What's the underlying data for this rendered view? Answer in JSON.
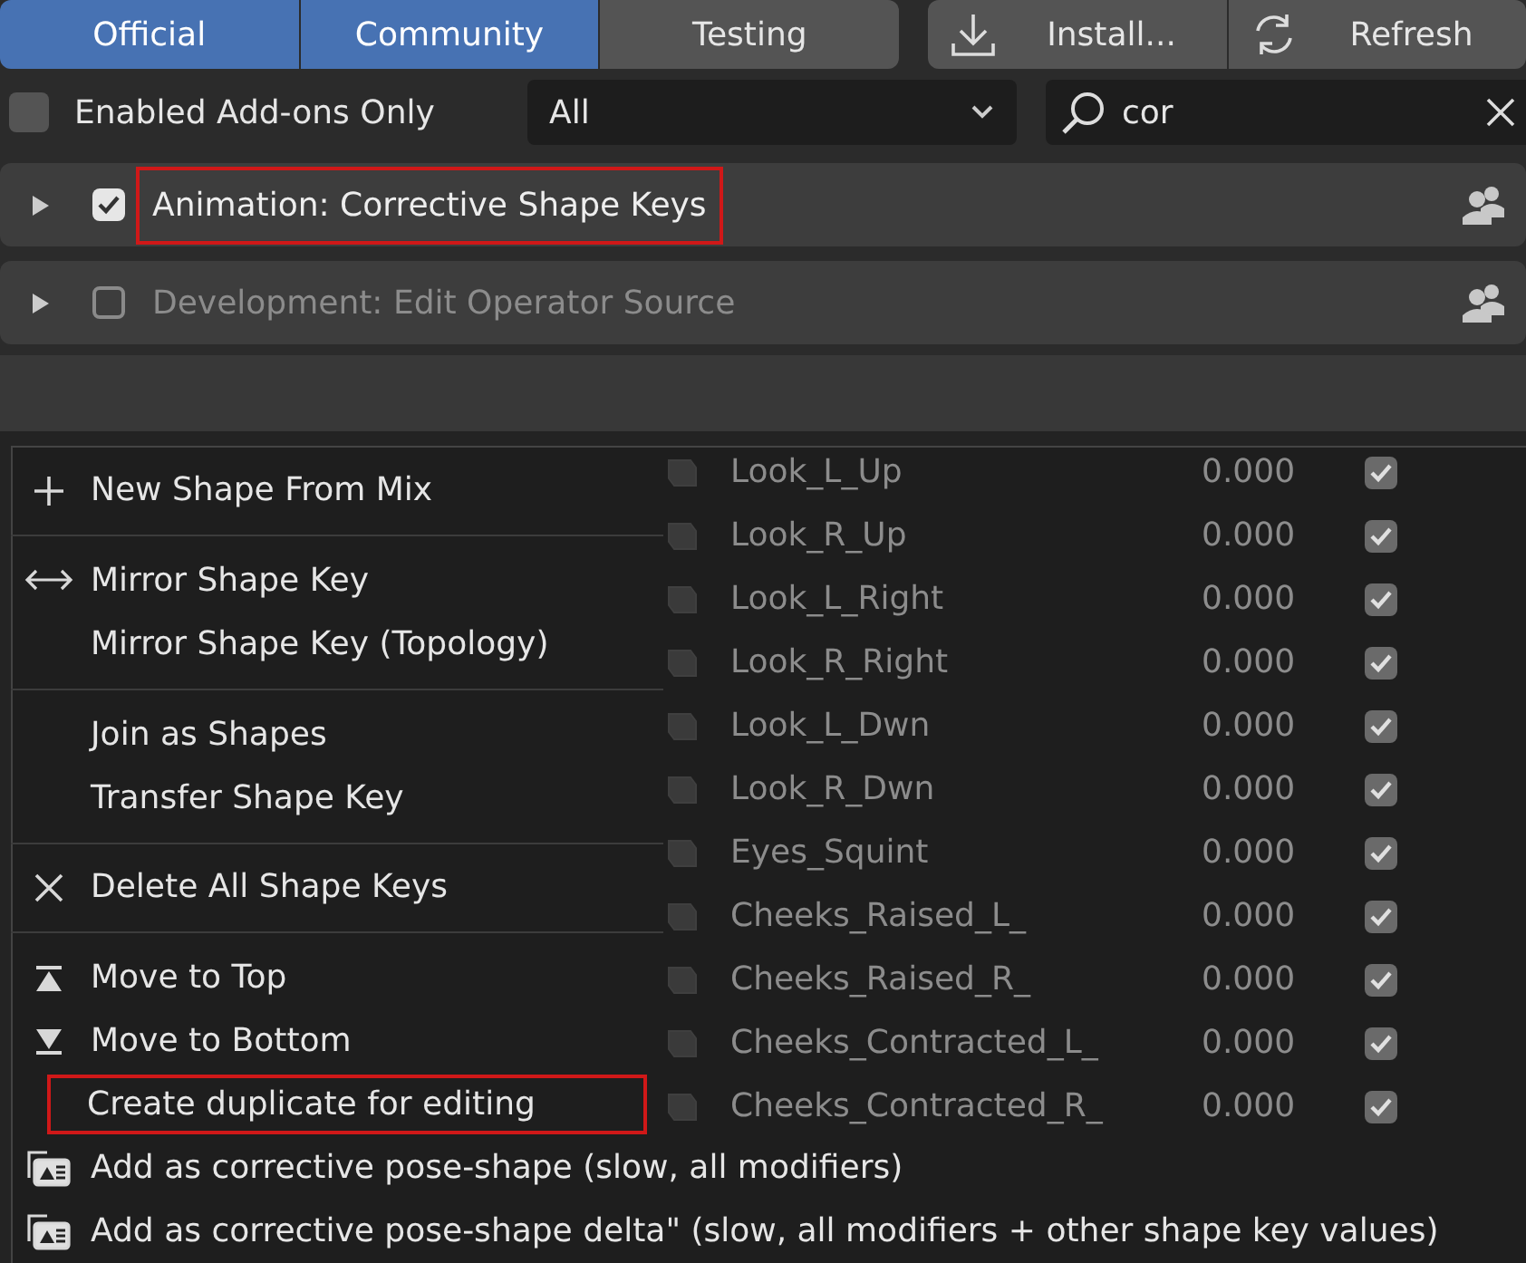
{
  "tabs": [
    {
      "label": "Official",
      "selected": true
    },
    {
      "label": "Community",
      "selected": true
    },
    {
      "label": "Testing",
      "selected": false
    }
  ],
  "actions": [
    {
      "label": "Install...",
      "kind": "install"
    },
    {
      "label": "Refresh",
      "kind": "refresh"
    }
  ],
  "filter": {
    "enabled_only": {
      "label": "Enabled Add-ons Only",
      "checked": false
    },
    "category": "All",
    "search": "cor"
  },
  "addons": [
    {
      "name": "Animation: Corrective Shape Keys",
      "enabled": true,
      "expanded": false,
      "highlighted": true
    },
    {
      "name": "Development: Edit Operator Source",
      "enabled": false,
      "expanded": false,
      "highlighted": false
    }
  ],
  "shape_keys": [
    {
      "name": "Look_L_Up",
      "value": "0.000",
      "checked": true
    },
    {
      "name": "Look_R_Up",
      "value": "0.000",
      "checked": true
    },
    {
      "name": "Look_L_Right",
      "value": "0.000",
      "checked": true
    },
    {
      "name": "Look_R_Right",
      "value": "0.000",
      "checked": true
    },
    {
      "name": "Look_L_Dwn",
      "value": "0.000",
      "checked": true
    },
    {
      "name": "Look_R_Dwn",
      "value": "0.000",
      "checked": true
    },
    {
      "name": "Eyes_Squint",
      "value": "0.000",
      "checked": true
    },
    {
      "name": "Cheeks_Raised_L_",
      "value": "0.000",
      "checked": true
    },
    {
      "name": "Cheeks_Raised_R_",
      "value": "0.000",
      "checked": true
    },
    {
      "name": "Cheeks_Contracted_L_",
      "value": "0.000",
      "checked": true
    },
    {
      "name": "Cheeks_Contracted_R_",
      "value": "0.000",
      "checked": true
    }
  ],
  "menu": [
    {
      "kind": "plus",
      "label": "New Shape From Mix",
      "highlighted": false
    },
    {
      "kind": "separator"
    },
    {
      "kind": "mirror",
      "label": "Mirror Shape Key",
      "highlighted": false
    },
    {
      "kind": "plain",
      "label": "Mirror Shape Key (Topology)",
      "highlighted": false
    },
    {
      "kind": "separator"
    },
    {
      "kind": "plain",
      "label": "Join as Shapes",
      "highlighted": false
    },
    {
      "kind": "plain",
      "label": "Transfer Shape Key",
      "highlighted": false
    },
    {
      "kind": "separator"
    },
    {
      "kind": "delete",
      "label": "Delete All Shape Keys",
      "highlighted": false
    },
    {
      "kind": "separator"
    },
    {
      "kind": "top",
      "label": "Move to Top",
      "highlighted": false
    },
    {
      "kind": "bottom",
      "label": "Move to Bottom",
      "highlighted": false
    },
    {
      "kind": "plain",
      "label": "Create duplicate for editing",
      "highlighted": true
    },
    {
      "kind": "pose",
      "label": "Add as corrective pose-shape (slow, all modifiers)",
      "highlighted": false
    },
    {
      "kind": "pose",
      "label": "Add as corrective pose-shape delta\" (slow, all modifiers + other shape key values)",
      "highlighted": false
    }
  ]
}
